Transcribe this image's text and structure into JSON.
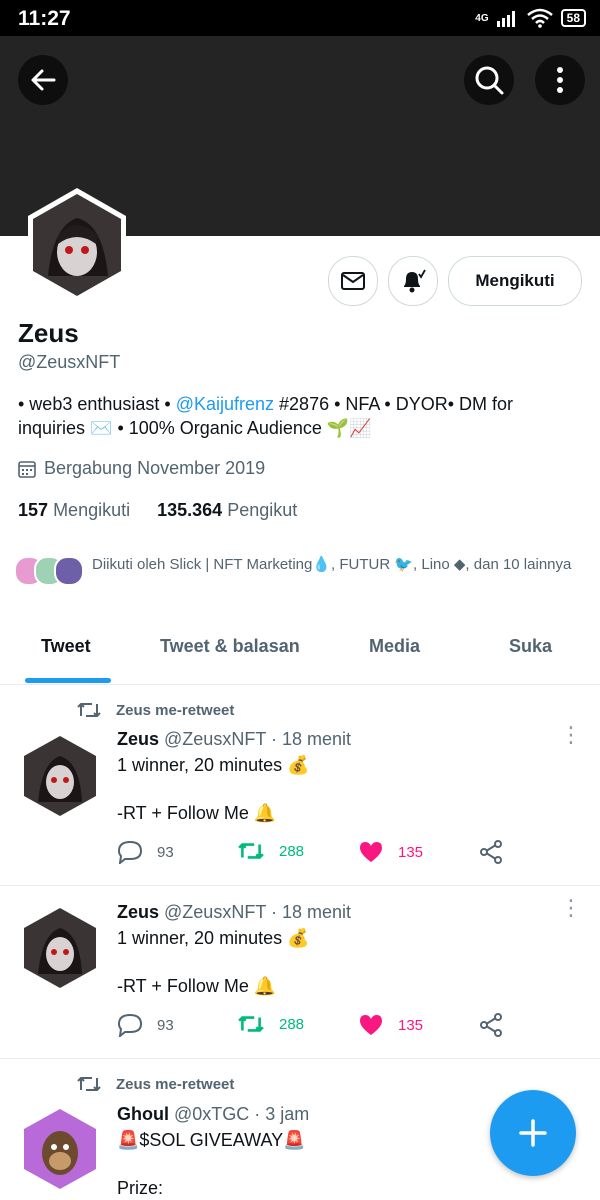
{
  "status_bar": {
    "time": "11:27",
    "network": "4G",
    "battery": "58"
  },
  "profile": {
    "name": "Zeus",
    "handle": "@ZeusxNFT",
    "bio_part1": "• web3 enthusiast • ",
    "bio_link": "@Kaijufrenz",
    "bio_part2": " #2876 • NFA • DYOR• DM for inquiries ✉️ • 100% Organic Audience 🌱📈",
    "joined": "Bergabung November 2019",
    "following_count": "157",
    "following_label": "Mengikuti",
    "followers_count": "135.364",
    "followers_label": "Pengikut",
    "followed_by": "Diikuti oleh Slick | NFT Marketing💧, FUTUR 🐦, Lino ◆, dan 10 lainnya",
    "follow_button": "Mengikuti"
  },
  "tabs": [
    {
      "label": "Tweet",
      "active": true
    },
    {
      "label": "Tweet & balasan",
      "active": false
    },
    {
      "label": "Media",
      "active": false
    },
    {
      "label": "Suka",
      "active": false
    }
  ],
  "tweets": [
    {
      "retweet_label": "Zeus me-retweet",
      "name": "Zeus",
      "meta": "@ZeusxNFT · 18 menit",
      "text": "1 winner, 20 minutes 💰\n\n-RT + Follow Me 🔔",
      "replies": "93",
      "retweets": "288",
      "likes": "135"
    },
    {
      "name": "Zeus",
      "meta": "@ZeusxNFT · 18 menit",
      "text": "1 winner, 20 minutes 💰\n\n-RT + Follow Me 🔔",
      "replies": "93",
      "retweets": "288",
      "likes": "135"
    },
    {
      "retweet_label": "Zeus me-retweet",
      "name": "Ghoul",
      "meta": "@0xTGC · 3 jam",
      "text": "🚨$SOL GIVEAWAY🚨\n\nPrize:"
    }
  ],
  "colors": {
    "accent": "#1d9bf0",
    "retweet": "#00ba7c",
    "like": "#f91880",
    "muted": "#536471"
  },
  "icons": [
    "back-arrow-icon",
    "search-icon",
    "more-vertical-icon",
    "mail-icon",
    "bell-icon",
    "calendar-icon",
    "retweet-icon",
    "reply-icon",
    "like-icon",
    "share-icon",
    "plus-icon"
  ]
}
